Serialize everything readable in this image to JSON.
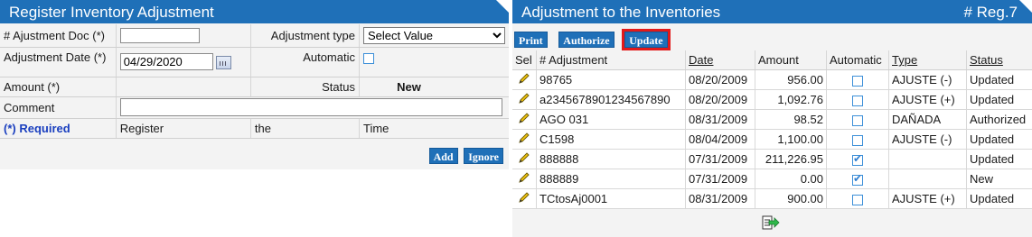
{
  "left": {
    "title": "Register Inventory Adjustment",
    "fields": {
      "adj_doc_label": "# Ajustment Doc (*)",
      "adj_doc_value": "",
      "adj_type_label": "Adjustment type",
      "adj_type_value": "Select Value",
      "adj_date_label": "Adjustment Date (*)",
      "adj_date_value": "04/29/2020",
      "automatic_label": "Automatic",
      "amount_label": "Amount (*)",
      "status_label": "Status",
      "status_value": "New",
      "comment_label": "Comment",
      "comment_value": ""
    },
    "footer_row": [
      "(*) Required",
      "Register",
      "the",
      "Time"
    ],
    "buttons": {
      "add": "Add",
      "ignore": "Ignore"
    }
  },
  "right": {
    "title": "Adjustment to the Inventories",
    "reg": "# Reg.7",
    "toolbar": {
      "print": "Print",
      "authorize": "Authorize",
      "update": "Update"
    },
    "columns": [
      "Sel",
      "# Adjustment",
      "Date",
      "Amount",
      "Automatic",
      "Type",
      "Status"
    ],
    "rows": [
      {
        "adjustment": "98765",
        "date": "08/20/2009",
        "amount": "956.00",
        "automatic": false,
        "type": "AJUSTE (-)",
        "status": "Updated"
      },
      {
        "adjustment": "a2345678901234567890",
        "date": "08/20/2009",
        "amount": "1,092.76",
        "automatic": false,
        "type": "AJUSTE (+)",
        "status": "Updated"
      },
      {
        "adjustment": "AGO 031",
        "date": "08/31/2009",
        "amount": "98.52",
        "automatic": false,
        "type": "DAÑADA",
        "status": "Authorized"
      },
      {
        "adjustment": "C1598",
        "date": "08/04/2009",
        "amount": "1,100.00",
        "automatic": false,
        "type": "AJUSTE (-)",
        "status": "Updated"
      },
      {
        "adjustment": "888888",
        "date": "07/31/2009",
        "amount": "211,226.95",
        "automatic": true,
        "type": "",
        "status": "Updated"
      },
      {
        "adjustment": "888889",
        "date": "07/31/2009",
        "amount": "0.00",
        "automatic": true,
        "type": "",
        "status": "New"
      },
      {
        "adjustment": "TCtosAj0001",
        "date": "08/31/2009",
        "amount": "900.00",
        "automatic": false,
        "type": "AJUSTE (+)",
        "status": "Updated"
      }
    ]
  },
  "colors": {
    "header_blue": "#1f70b8",
    "highlight_red": "#e21a1a",
    "checkbox_blue": "#3c8fd8"
  },
  "icons": {
    "row_select": "pencil-icon",
    "calendar": "calendar-icon",
    "export": "export-icon"
  }
}
